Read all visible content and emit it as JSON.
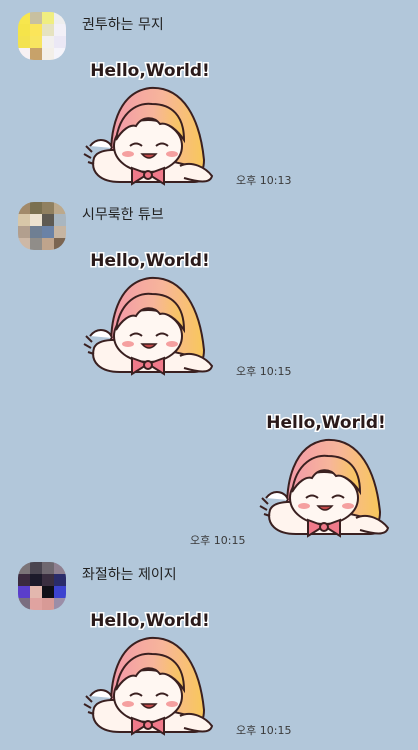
{
  "messages": [
    {
      "sender": "권투하는 무지",
      "time": "오후 10:13",
      "outgoing": false,
      "sticker_text": "Hello,World!",
      "avatar_colors": [
        "#f7e64d",
        "#c8c0a0",
        "#f0ee80",
        "#eeeeee",
        "#f5e44a",
        "#fbe55a",
        "#e6e3c0",
        "#f2f0f7",
        "#f3e24f",
        "#f8e560",
        "#f2f0ee",
        "#ebe8f5",
        "#f7f1f3",
        "#c7a26a",
        "#f3efe8",
        "#f5f4fa"
      ]
    },
    {
      "sender": "시무룩한 튜브",
      "time": "오후 10:15",
      "outgoing": false,
      "sticker_text": "Hello,World!",
      "avatar_colors": [
        "#a28a6a",
        "#7a7050",
        "#908060",
        "#bca98c",
        "#d8c7a8",
        "#ece2d0",
        "#5e5a52",
        "#a9b6c0",
        "#b29f8e",
        "#6f7f93",
        "#6a82a6",
        "#c6b5a2",
        "#cdb8a6",
        "#908d89",
        "#bfa48c",
        "#7b6551"
      ]
    },
    {
      "sender": "",
      "time": "오후 10:15",
      "outgoing": true,
      "sticker_text": "Hello,World!",
      "avatar_colors": []
    },
    {
      "sender": "좌절하는 제이지",
      "time": "오후 10:15",
      "outgoing": false,
      "sticker_text": "Hello,World!",
      "avatar_colors": [
        "#7b7478",
        "#4a4550",
        "#6f6870",
        "#8f8090",
        "#3b2a3e",
        "#1c1a2a",
        "#3a2e40",
        "#2a2c6a",
        "#5a3ecb",
        "#e3b7ae",
        "#101018",
        "#3c43d0",
        "#7a6e80",
        "#e0a3a0",
        "#d89a96",
        "#9b8ea8"
      ]
    }
  ]
}
